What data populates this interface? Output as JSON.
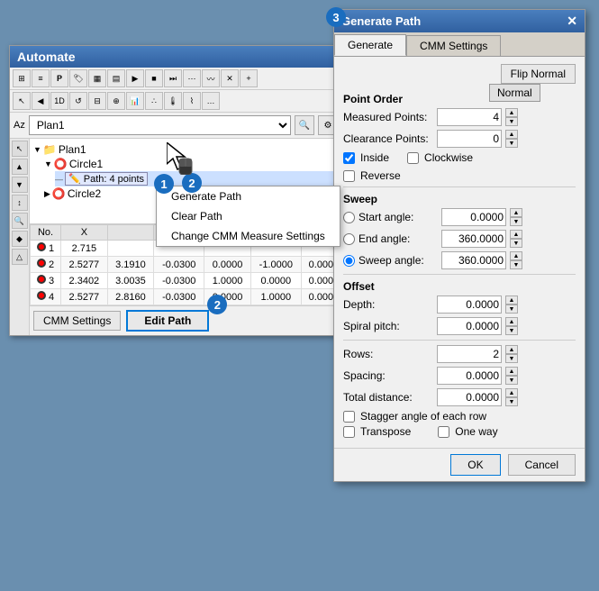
{
  "automate": {
    "title": "Automate",
    "toolbar_rows": [
      [
        "grid",
        "list",
        "P",
        "tag",
        "table",
        "table2",
        "play",
        "stop",
        "step",
        "dots",
        "wave",
        "cross",
        "plus"
      ],
      [
        "cursor",
        "prev",
        "1D",
        "loop",
        "table3",
        "cursor2",
        "chart",
        "dots2",
        "thermo",
        "bars",
        "more"
      ]
    ],
    "dropdown": {
      "value": "Plan1",
      "placeholder": "Plan1"
    },
    "tree": {
      "items": [
        {
          "label": "Plan1",
          "level": 0,
          "type": "folder"
        },
        {
          "label": "Circle1",
          "level": 1,
          "type": "circle"
        },
        {
          "label": "Path: 4 points",
          "level": 2,
          "type": "path",
          "selected": true
        },
        {
          "label": "Circle2",
          "level": 1,
          "type": "circle"
        }
      ]
    },
    "context_menu": {
      "items": [
        {
          "label": "Generate Path"
        },
        {
          "label": "Clear Path"
        },
        {
          "label": "Change CMM Measure Settings"
        }
      ]
    },
    "table": {
      "headers": [
        "No.",
        "X",
        "",
        "",
        "",
        "",
        ""
      ],
      "rows": [
        {
          "no": "1",
          "x": "2.715",
          "v1": "",
          "v2": "",
          "v3": "",
          "v4": "",
          "v5": ""
        },
        {
          "no": "2",
          "x": "2.5277",
          "v1": "3.1910",
          "v2": "-0.0300",
          "v3": "0.0000",
          "v4": "-1.0000",
          "v5": "0.000"
        },
        {
          "no": "3",
          "x": "2.3402",
          "v1": "3.0035",
          "v2": "-0.0300",
          "v3": "1.0000",
          "v4": "0.0000",
          "v5": "0.000"
        },
        {
          "no": "4",
          "x": "2.5277",
          "v1": "2.8160",
          "v2": "-0.0300",
          "v3": "0.0000",
          "v4": "1.0000",
          "v5": "0.000"
        }
      ]
    },
    "buttons": {
      "cmm_settings": "CMM Settings",
      "edit_path": "Edit Path"
    }
  },
  "dialog": {
    "title": "Generate Path",
    "tabs": [
      "Generate",
      "CMM Settings"
    ],
    "active_tab": "Generate",
    "flip_normal": "Flip Normal",
    "point_order": {
      "label": "Point Order",
      "measured_points": {
        "label": "Measured Points:",
        "value": "4"
      },
      "clearance_points": {
        "label": "Clearance Points:",
        "value": "0"
      }
    },
    "checkboxes": {
      "inside": {
        "label": "Inside",
        "checked": true
      },
      "clockwise": {
        "label": "Clockwise",
        "checked": false
      },
      "reverse": {
        "label": "Reverse",
        "checked": false
      }
    },
    "sweep": {
      "label": "Sweep",
      "start_angle": {
        "label": "Start angle:",
        "value": "0.0000"
      },
      "end_angle": {
        "label": "End angle:",
        "value": "360.0000"
      },
      "sweep_angle": {
        "label": "Sweep angle:",
        "value": "360.0000"
      },
      "selected": "sweep_angle"
    },
    "offset": {
      "label": "Offset",
      "depth": {
        "label": "Depth:",
        "value": "0.0000"
      },
      "spiral_pitch": {
        "label": "Spiral pitch:",
        "value": "0.0000"
      }
    },
    "rows": {
      "label": "Rows:",
      "value": "2"
    },
    "spacing": {
      "label": "Spacing:",
      "value": "0.0000"
    },
    "total_distance": {
      "label": "Total distance:",
      "value": "0.0000"
    },
    "stagger_angle": {
      "label": "Stagger angle of each row",
      "checked": false
    },
    "transpose": {
      "label": "Transpose",
      "checked": false
    },
    "one_way": {
      "label": "One way",
      "checked": false
    },
    "ok": "OK",
    "cancel": "Cancel"
  },
  "badges": {
    "badge1": "1",
    "badge2_tree": "2",
    "badge2_btn": "2",
    "badge3": "3"
  },
  "normal_badge": "Normal"
}
